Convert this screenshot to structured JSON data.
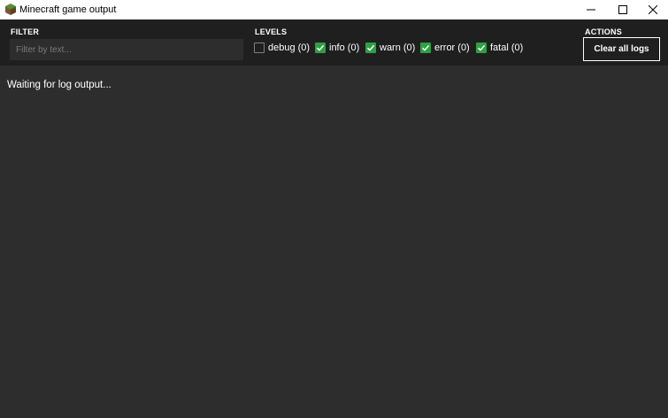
{
  "window": {
    "title": "Minecraft game output",
    "app_icon": "minecraft-grass-block-icon",
    "controls": [
      "minimize-icon",
      "maximize-icon",
      "close-icon"
    ]
  },
  "filter": {
    "label": "FILTER",
    "placeholder": "Filter by text...",
    "value": ""
  },
  "levels": {
    "label": "LEVELS",
    "items": [
      {
        "label": "debug (0)",
        "checked": false
      },
      {
        "label": "info (0)",
        "checked": true
      },
      {
        "label": "warn (0)",
        "checked": true
      },
      {
        "label": "error (0)",
        "checked": true
      },
      {
        "label": "fatal (0)",
        "checked": true
      }
    ]
  },
  "actions": {
    "label": "ACTIONS",
    "clear_label": "Clear all logs"
  },
  "log": {
    "status_text": "Waiting for log output..."
  },
  "colors": {
    "titlebar": "#ffffff",
    "toolbar": "#1f1f1f",
    "background": "#2d2d2d",
    "checkbox_checked": "#2ea043",
    "text": "#ffffff"
  }
}
